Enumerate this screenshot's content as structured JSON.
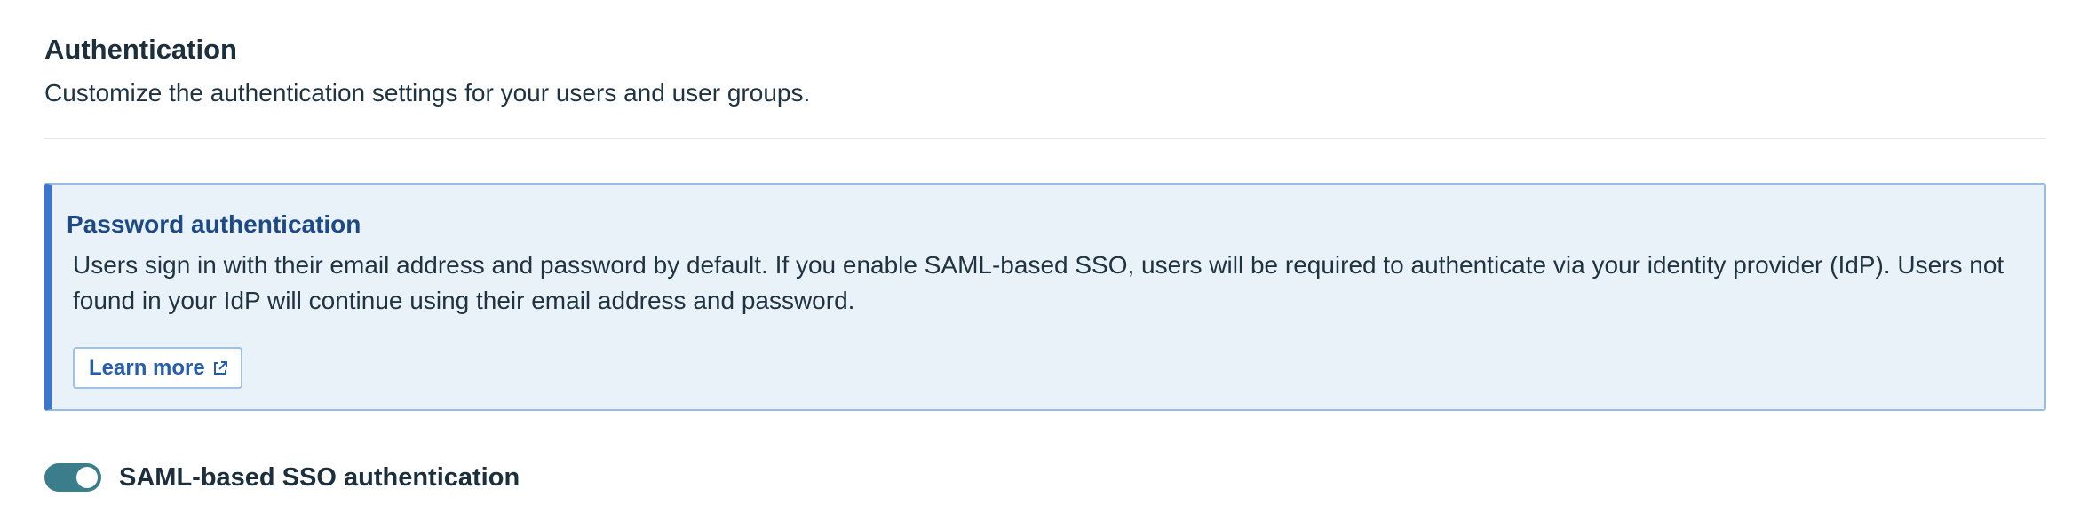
{
  "header": {
    "title": "Authentication",
    "subtitle": "Customize the authentication settings for your users and user groups."
  },
  "callout": {
    "title": "Password authentication",
    "body": "Users sign in with their email address and password by default. If you enable SAML-based SSO, users will be required to authenticate via your identity provider (IdP). Users not found in your IdP will continue using their email address and password.",
    "learn_more_label": "Learn more",
    "learn_more_icon": "external-link-icon"
  },
  "saml_toggle": {
    "label": "SAML-based SSO authentication",
    "enabled": true
  },
  "colors": {
    "toggle_on": "#3b7d8b",
    "callout_bg": "#e9f1f9",
    "callout_accent": "#3a78cf",
    "link": "#255fab"
  }
}
